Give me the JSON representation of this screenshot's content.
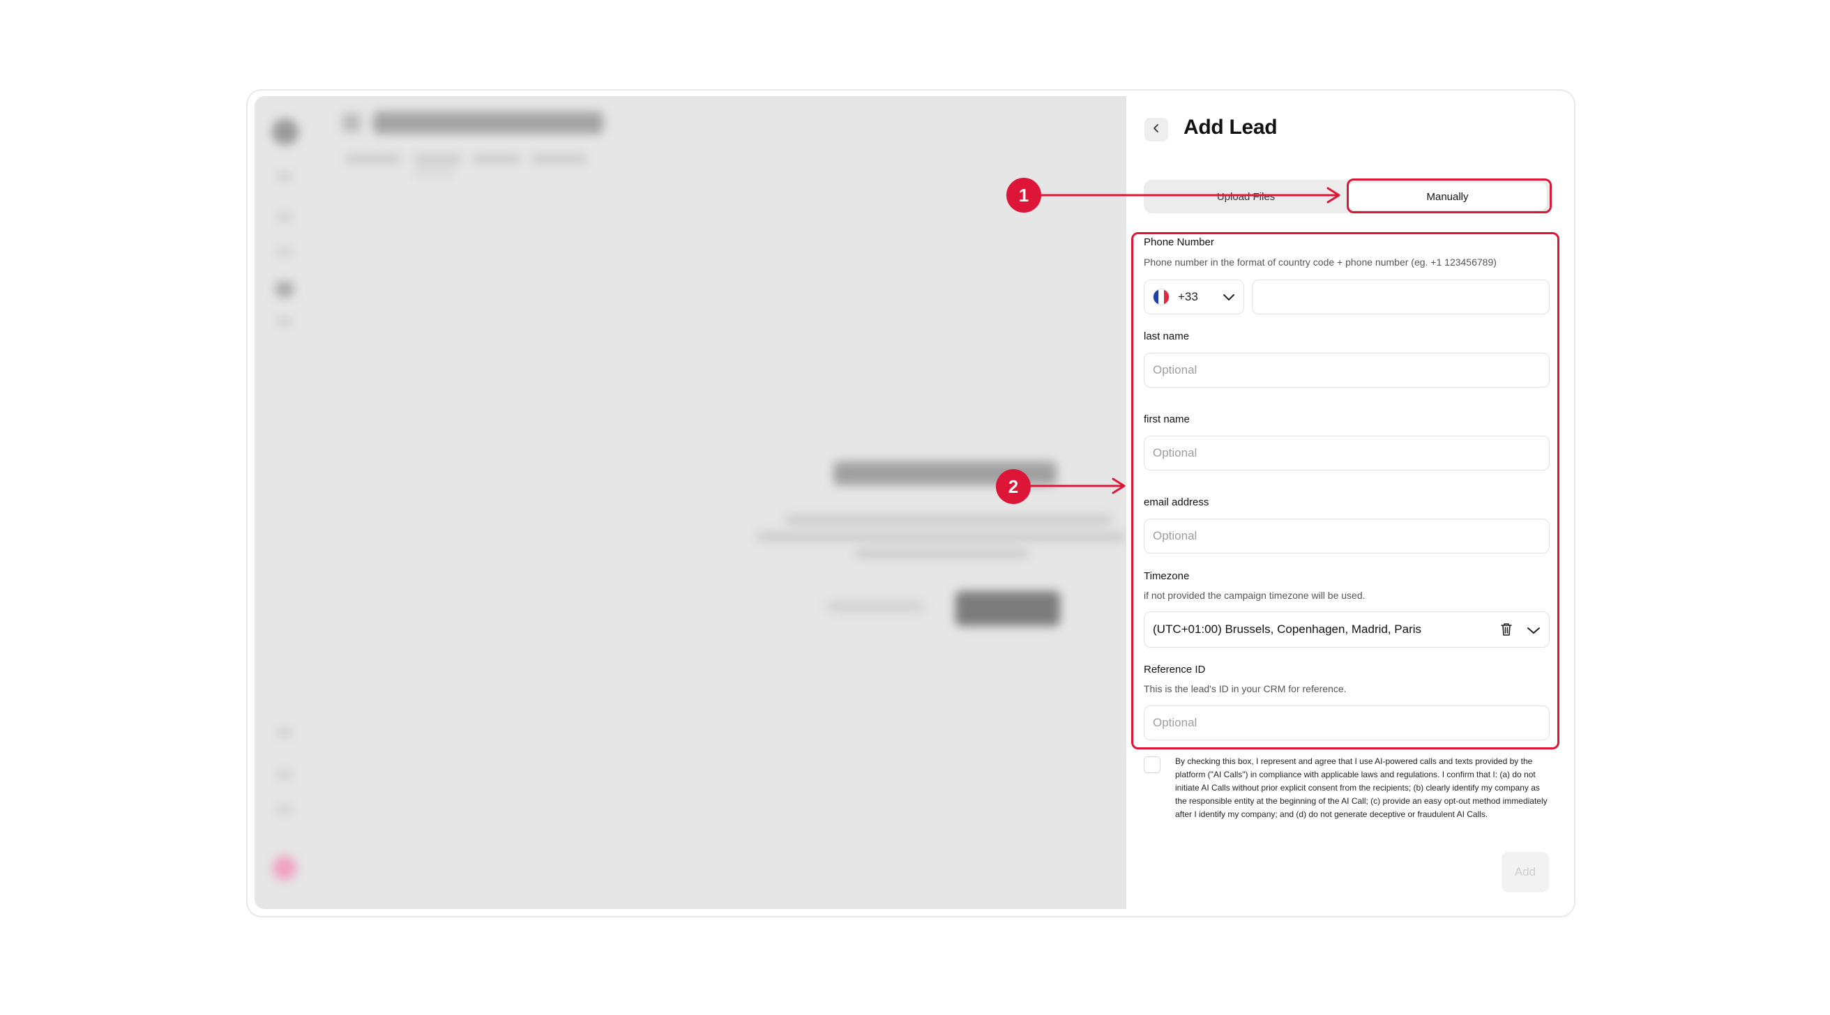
{
  "panel": {
    "title": "Add Lead",
    "tabs": [
      {
        "label": "Upload Files",
        "active": false
      },
      {
        "label": "Manually",
        "active": true
      }
    ]
  },
  "form": {
    "phone": {
      "label": "Phone Number",
      "hint": "Phone number in the format of country code + phone number (eg. +1 123456789)",
      "country_code": "+33",
      "country_flag": "France",
      "value": ""
    },
    "last_name": {
      "label": "last name",
      "placeholder": "Optional"
    },
    "first_name": {
      "label": "first name",
      "placeholder": "Optional"
    },
    "email": {
      "label": "email address",
      "placeholder": "Optional"
    },
    "timezone": {
      "label": "Timezone",
      "hint": "if not provided the campaign timezone will be used.",
      "value": "(UTC+01:00) Brussels, Copenhagen, Madrid, Paris"
    },
    "reference": {
      "label": "Reference ID",
      "hint": "This is the lead's ID in your CRM for reference.",
      "placeholder": "Optional"
    },
    "consent_text": "By checking this box, I represent and agree that I use AI-powered calls and texts provided by the platform (\"AI Calls\") in compliance with applicable laws and regulations. I confirm that I: (a) do not initiate AI Calls without prior explicit consent from the recipients; (b) clearly identify my company as the responsible entity at the beginning of the AI Call; (c) provide an easy opt-out method immediately after I identify my company; and (d) do not generate deceptive or fraudulent AI Calls.",
    "consent_checked": false,
    "add_label": "Add"
  },
  "annotations": [
    {
      "number": "1"
    },
    {
      "number": "2"
    }
  ],
  "colors": {
    "annotation": "#dd1638",
    "backdrop": "#e6e6e6"
  }
}
